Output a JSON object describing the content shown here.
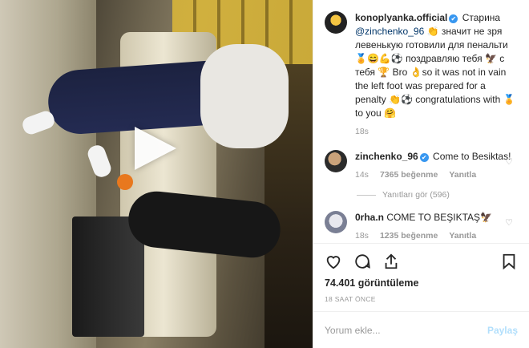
{
  "caption": {
    "username": "konoplyanka.official",
    "verified_mark": "✔",
    "text_before_mention": " Старина ",
    "mention": "@zinchenko_96",
    "text_after_mention": " 👏 значит не зря левенькую готовили для пенальти 🏅😄💪⚽ поздравляю тебя 🦅 с тебя 🏆 Bro 👌so it was not in vain the left foot was prepared for a penalty 👏⚽ congratulations with 🏅 to you 🤗",
    "time": "18s"
  },
  "comments": [
    {
      "username": "zinchenko_96",
      "verified_mark": "✔",
      "text": " Come to Besiktas!",
      "time": "14s",
      "likes": "7365 beğenme",
      "reply": "Yanıtla",
      "heart": "♡",
      "view_replies": "Yanıtları gör (596)"
    },
    {
      "username": "0rha.n",
      "text": " COME TO BEŞIKTAŞ🦅",
      "time": "18s",
      "likes": "1235 beğenme",
      "reply": "Yanıtla",
      "heart": "♡"
    }
  ],
  "actions": {
    "icons": [
      "heart-icon",
      "comment-icon",
      "share-icon",
      "bookmark-icon"
    ],
    "views": "74.401 görüntüleme",
    "posted_ago": "18 SAAT ÖNCE"
  },
  "add_comment": {
    "placeholder": "Yorum ekle...",
    "post_label": "Paylaş"
  },
  "colors": {
    "link": "#003569",
    "verified": "#3897f0",
    "muted": "#999999",
    "post_disabled": "#b2dffc"
  }
}
